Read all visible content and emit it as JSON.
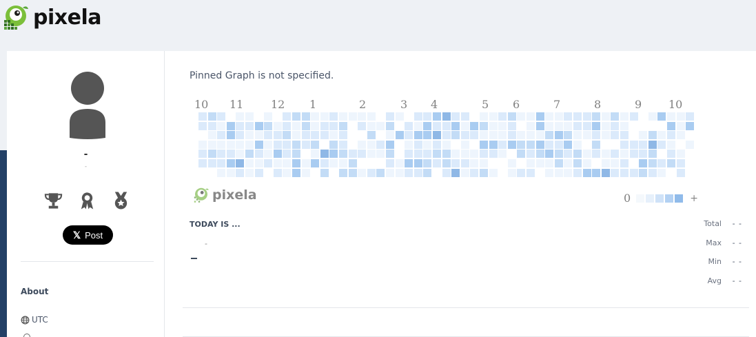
{
  "app": {
    "logo_text": "pixela"
  },
  "profile": {
    "display_name": "-",
    "sub_text": "-",
    "badges": [
      "trophy-icon",
      "award-ribbon-icon",
      "medal-star-icon"
    ],
    "post_button_label": "Post",
    "post_button_glyph": "𝕏"
  },
  "about": {
    "title": "About",
    "timezone": "UTC"
  },
  "pinned": {
    "message": "Pinned Graph is not specified."
  },
  "graph": {
    "month_labels": [
      "10",
      "11",
      "12",
      "1",
      "2",
      "3",
      "4",
      "5",
      "6",
      "7",
      "8",
      "9",
      "10"
    ],
    "weeks": 53,
    "colors": [
      "#ffffff",
      "#eef5fd",
      "#dbeafb",
      "#c3dcf6",
      "#a9ccf1",
      "#8fb8e6"
    ],
    "logo_text": "pixela"
  },
  "legend": {
    "min_label": "0",
    "max_label": "+",
    "colors": [
      "#f4f8fc",
      "#e6f0fb",
      "#cfe2f8",
      "#b3d1f3",
      "#90bbea"
    ]
  },
  "today": {
    "label": "TODAY IS ...",
    "value": "-",
    "unit": "–"
  },
  "stats": [
    {
      "label": "Total",
      "value": "- -"
    },
    {
      "label": "Max",
      "value": "- -"
    },
    {
      "label": "Min",
      "value": "- -"
    },
    {
      "label": "Avg",
      "value": "- -"
    }
  ]
}
